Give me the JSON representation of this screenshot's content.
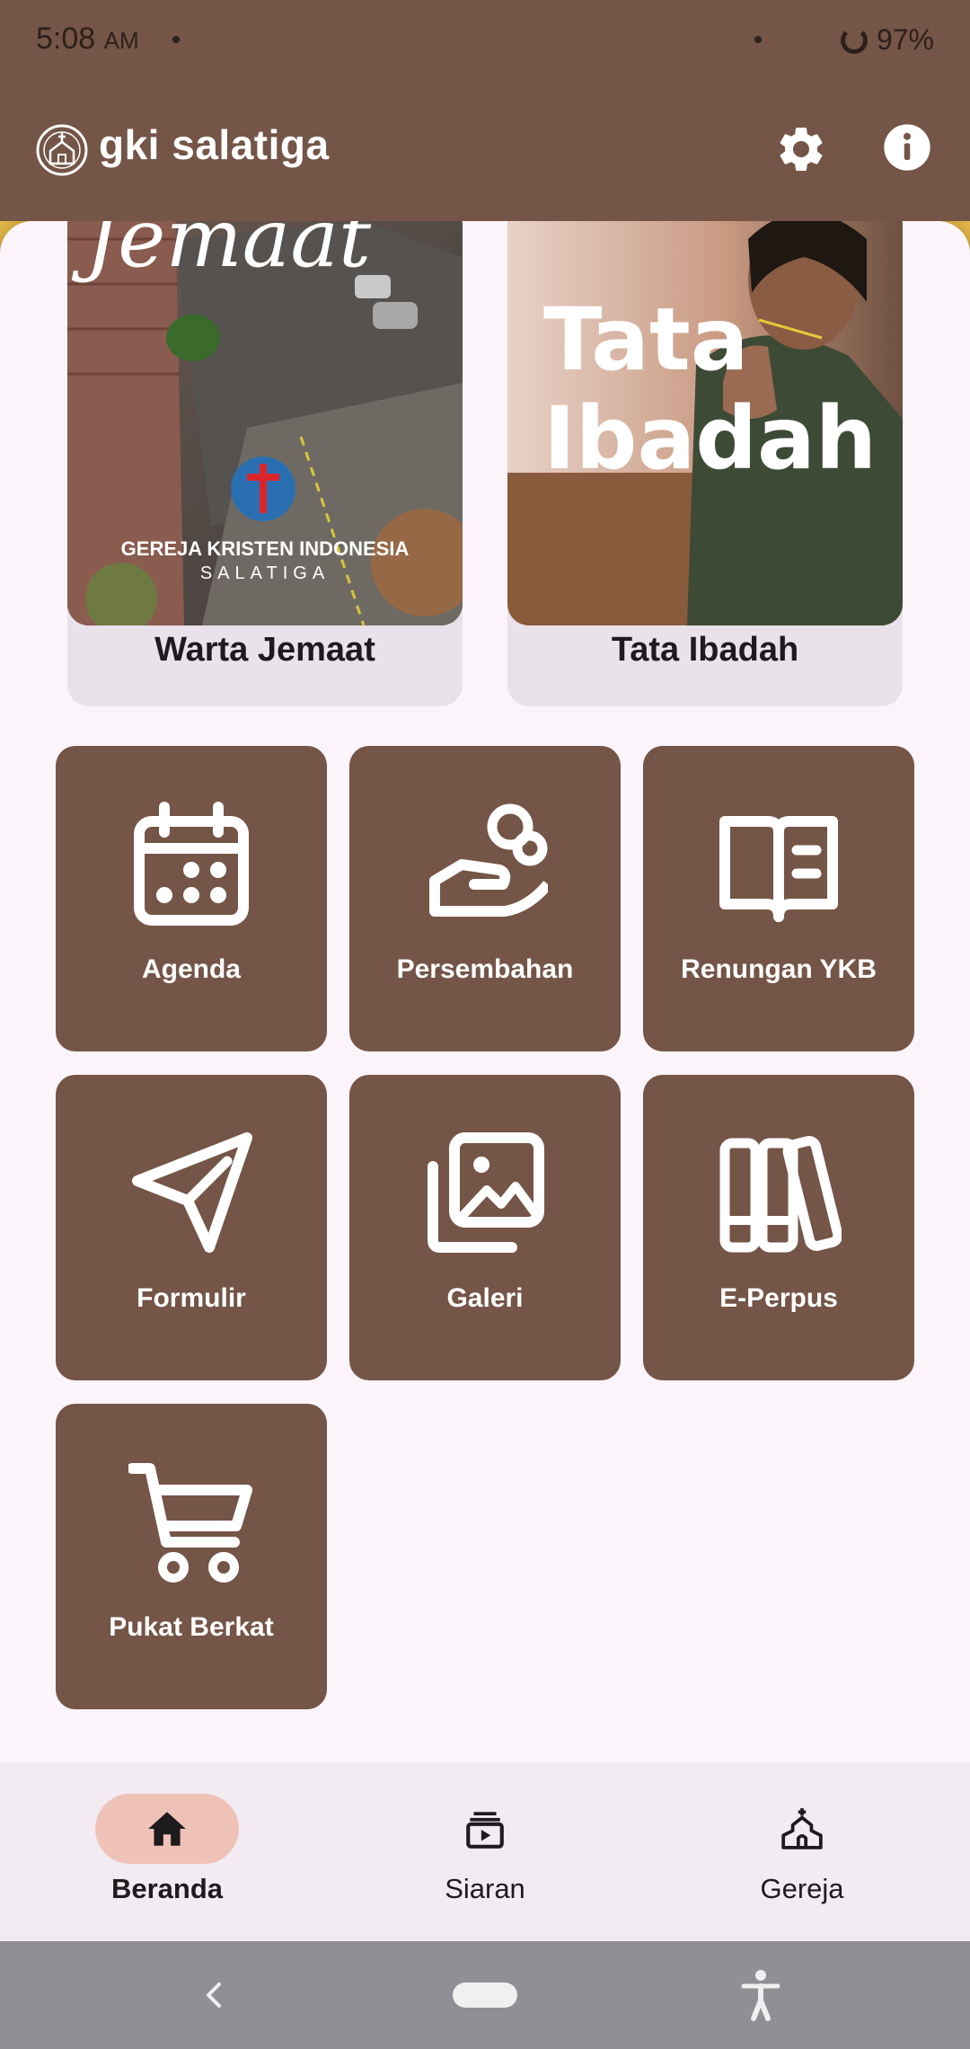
{
  "status_bar": {
    "time": "5:08",
    "ampm": "AM",
    "battery": "97%"
  },
  "app_bar": {
    "title": "gki salatiga"
  },
  "banners": [
    {
      "label": "Warta Jemaat",
      "image_text_top": "Jemaat",
      "image_text_line1": "GEREJA KRISTEN INDONESIA",
      "image_text_line2": "SALATIGA"
    },
    {
      "label": "Tata Ibadah",
      "image_text_line1": "Tata",
      "image_text_line2": "Ibadah"
    }
  ],
  "menu": [
    {
      "label": "Agenda",
      "icon": "calendar-icon"
    },
    {
      "label": "Persembahan",
      "icon": "offering-hand-icon"
    },
    {
      "label": "Renungan YKB",
      "icon": "open-book-icon"
    },
    {
      "label": "Formulir",
      "icon": "send-icon"
    },
    {
      "label": "Galeri",
      "icon": "gallery-icon"
    },
    {
      "label": "E-Perpus",
      "icon": "books-icon"
    },
    {
      "label": "Pukat Berkat",
      "icon": "cart-icon"
    }
  ],
  "bottom_nav": [
    {
      "label": "Beranda",
      "icon": "home-icon",
      "active": true
    },
    {
      "label": "Siaran",
      "icon": "broadcast-icon",
      "active": false
    },
    {
      "label": "Gereja",
      "icon": "church-icon",
      "active": false
    }
  ],
  "colors": {
    "primary": "#745547",
    "background": "#fbf4fa",
    "nav_active": "#efc2b8",
    "card": "#e9e2ea"
  }
}
